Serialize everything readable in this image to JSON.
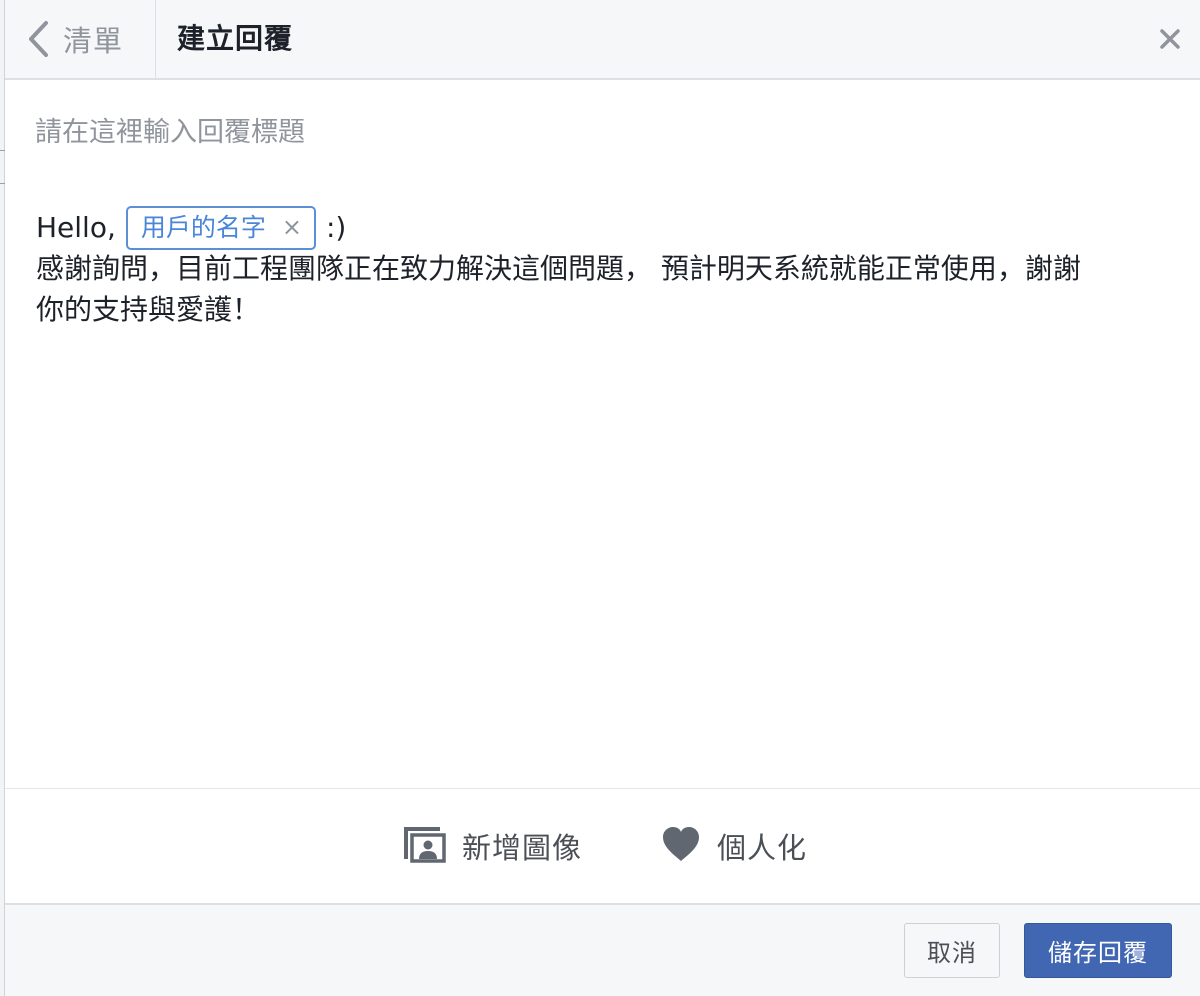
{
  "header": {
    "back_label": "清單",
    "title": "建立回覆",
    "close_label": "×"
  },
  "editor": {
    "title_placeholder": "請在這裡輸入回覆標題",
    "title_value": "",
    "message": {
      "greeting": "Hello,",
      "token_label": "用戶的名字",
      "token_remove": "×",
      "after_token": ":)",
      "line2": "感謝詢問，目前工程團隊正在致力解決這個問題， 預計明天系統就能正常使用，謝謝",
      "line3": "你的支持與愛護！"
    }
  },
  "toolbar": {
    "add_image_label": "新增圖像",
    "add_image_icon": "add-image-icon",
    "personalize_label": "個人化",
    "personalize_icon": "heart-icon"
  },
  "actions": {
    "cancel_label": "取消",
    "save_label": "儲存回覆"
  },
  "colors": {
    "primary": "#4267b2",
    "token_border": "#5b8fd6",
    "token_text": "#4a86d8",
    "muted_text": "#90949c",
    "icon_gray": "#606770"
  }
}
